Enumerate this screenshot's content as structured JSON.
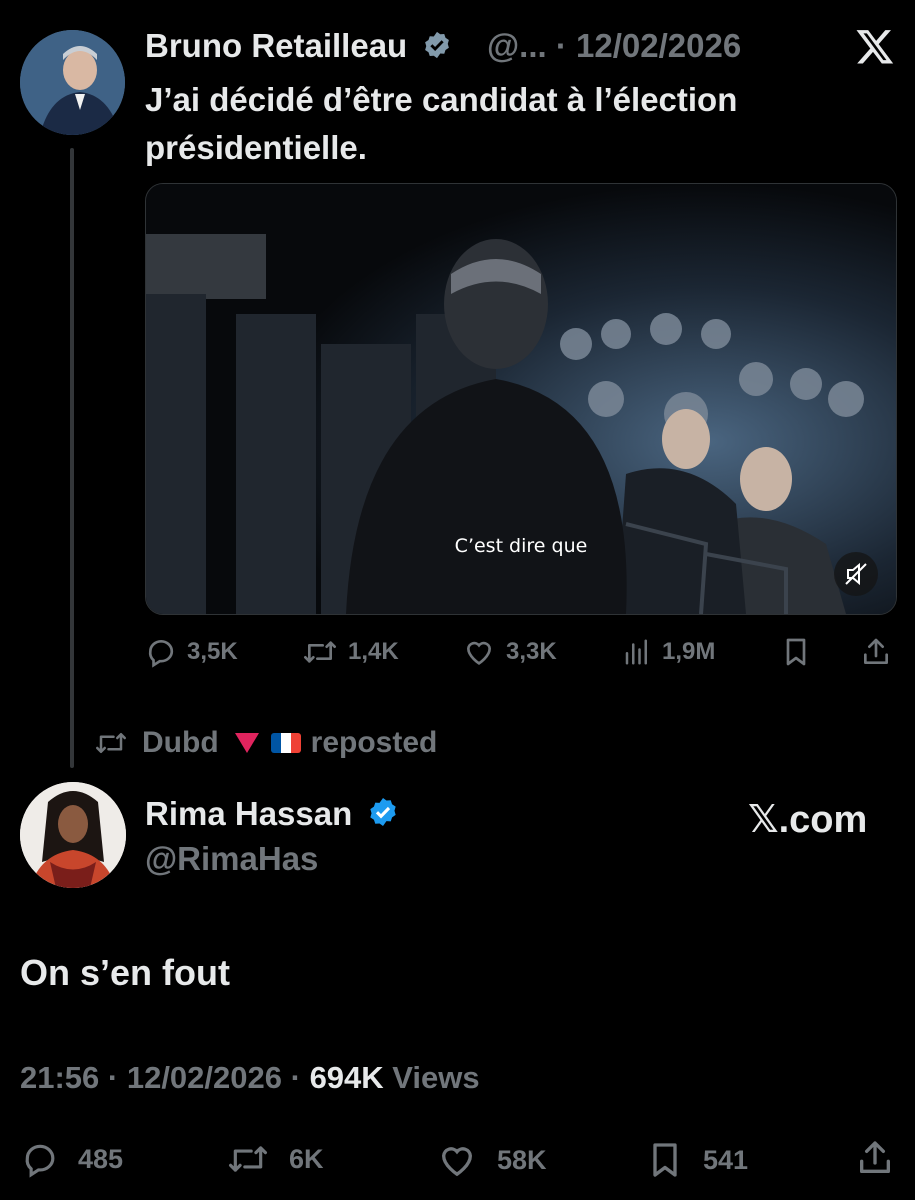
{
  "quoted_tweet": {
    "author_name": "Bruno Retailleau",
    "handle": "@...",
    "date": "· 12/02/2026",
    "text": "J’ai décidé d’être candidat à l’élection présidentielle.",
    "video_subtitle": "C’est dire que",
    "replies": "3,5K",
    "reposts": "1,4K",
    "likes": "3,3K",
    "views": "1,9M"
  },
  "repost_banner": {
    "reposter": "Dubd",
    "suffix": "reposted"
  },
  "main_tweet": {
    "author_name": "Rima Hassan",
    "handle": "@RimaHas",
    "site_label": "𝕏.com",
    "text": "On s’en fout",
    "time": "21:56 · 12/02/2026 ·",
    "views_count": "694K",
    "views_label": "Views",
    "replies": "485",
    "reposts": "6K",
    "likes": "58K",
    "bookmarks": "541"
  },
  "colors": {
    "background": "#000000",
    "text": "#e7e9ea",
    "muted": "#71767b",
    "verified": "#1d9bf0"
  },
  "icons": [
    "verified-badge-icon",
    "x-logo-icon",
    "reply-icon",
    "repost-icon",
    "like-icon",
    "views-icon",
    "bookmark-icon",
    "share-icon",
    "mute-icon",
    "red-triangle-icon",
    "french-flag-icon"
  ]
}
